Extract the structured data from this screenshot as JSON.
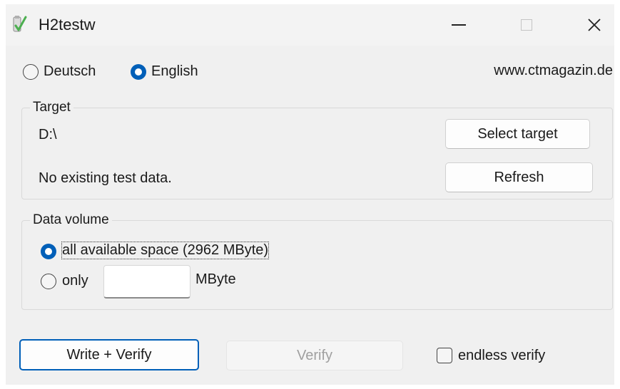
{
  "window": {
    "title": "H2testw",
    "icon": "h2testw-app-icon",
    "controls": {
      "minimize": "minimize-icon",
      "maximize": "maximize-icon",
      "close": "close-icon"
    }
  },
  "language": {
    "options": [
      {
        "label": "Deutsch",
        "selected": false
      },
      {
        "label": "English",
        "selected": true
      }
    ],
    "website": "www.ctmagazin.de"
  },
  "target": {
    "caption": "Target",
    "path": "D:\\",
    "status": "No existing test data.",
    "select_label": "Select target",
    "refresh_label": "Refresh"
  },
  "data_volume": {
    "caption": "Data volume",
    "all_label": "all available space (2962 MByte)",
    "all_selected": true,
    "only_label": "only",
    "only_value": "",
    "unit_label": "MByte"
  },
  "actions": {
    "write_verify_label": "Write + Verify",
    "verify_label": "Verify",
    "endless_verify_label": "endless verify",
    "endless_verify_checked": false
  },
  "colors": {
    "accent": "#005fb8",
    "window_bg": "#f0f0f0"
  }
}
